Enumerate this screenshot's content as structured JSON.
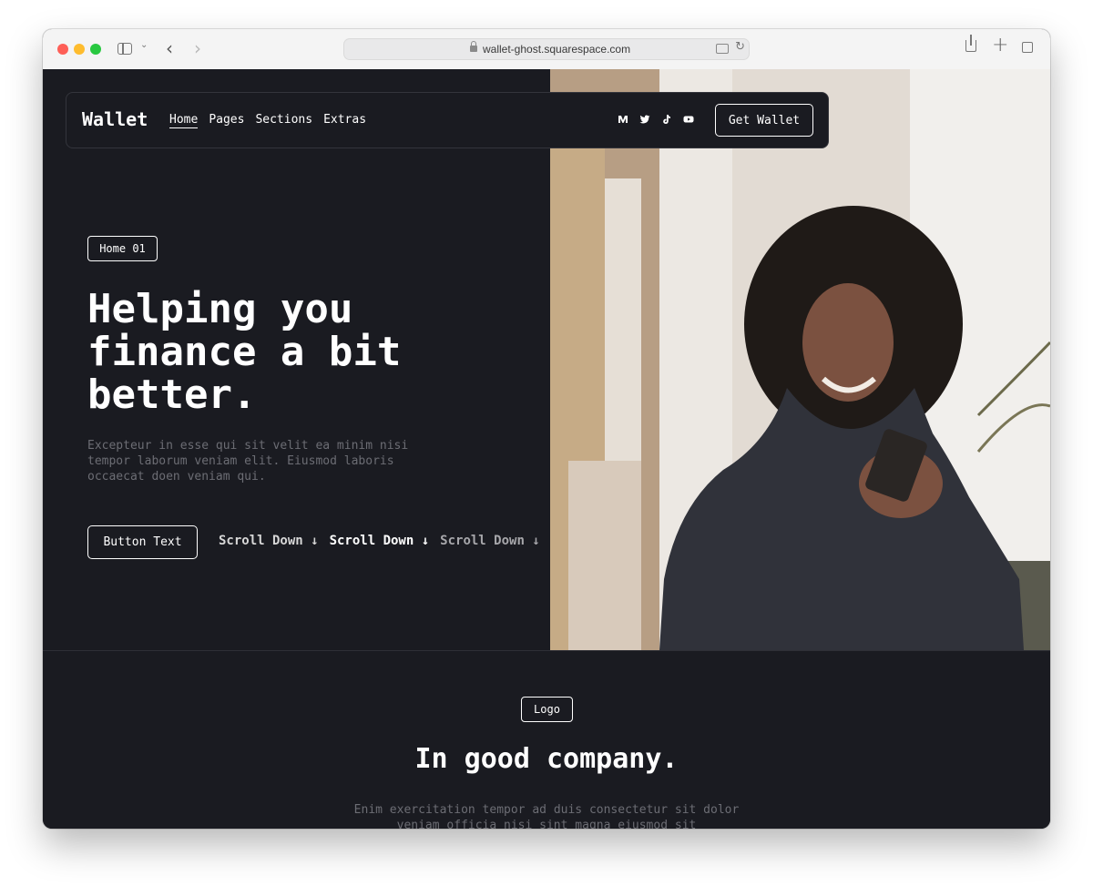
{
  "browser": {
    "url": "wallet-ghost.squarespace.com",
    "icons": [
      "sidebar-icon",
      "chevron-down-icon",
      "back-arrow-icon",
      "forward-arrow-icon",
      "lock-icon",
      "translate-icon",
      "reload-icon",
      "share-icon",
      "new-tab-icon",
      "tabs-icon"
    ]
  },
  "nav": {
    "logo": "Wallet",
    "links": [
      "Home",
      "Pages",
      "Sections",
      "Extras"
    ],
    "active_link": "Home",
    "socials": [
      "medium-icon",
      "twitter-icon",
      "tiktok-icon",
      "youtube-icon"
    ],
    "cta": "Get Wallet"
  },
  "hero": {
    "tag": "Home 01",
    "headline": "Helping you finance a bit better.",
    "description": "Excepteur in esse qui sit velit ea minim nisi tempor laborum veniam elit. Eiusmod laboris occaecat doen veniam qui.",
    "button": "Button Text",
    "scroll_items": [
      "Scroll Down ↓",
      "Scroll Down ↓",
      "Scroll Down ↓"
    ]
  },
  "logos_section": {
    "tag": "Logo",
    "title": "In good company.",
    "description": "Enim exercitation tempor ad duis consectetur sit dolor veniam officia nisi sint magna eiusmod sit"
  },
  "colors": {
    "background": "#1a1b21",
    "text": "#ffffff",
    "muted_text": "#6c6d74"
  }
}
